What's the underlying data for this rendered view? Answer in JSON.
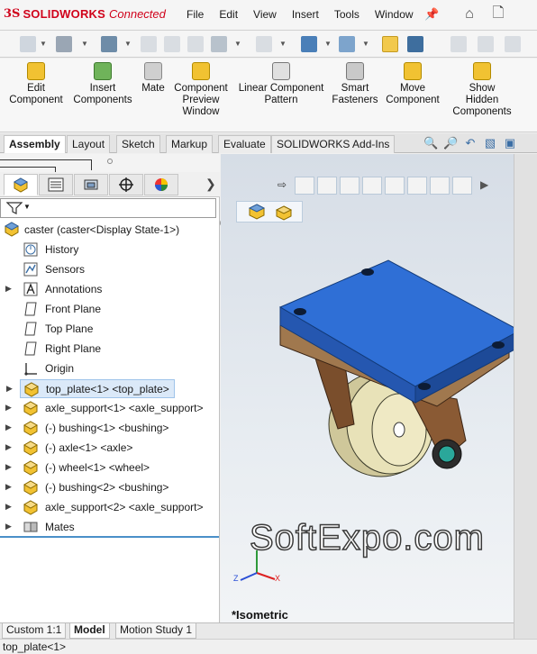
{
  "app": {
    "logo_ds": "3S",
    "logo_name": "SOLIDWORKS",
    "logo_suffix": "Connected"
  },
  "menu": [
    "File",
    "Edit",
    "View",
    "Insert",
    "Tools",
    "Window"
  ],
  "command_manager": [
    {
      "id": "edit-component",
      "label": "Edit\nComponent"
    },
    {
      "id": "insert-components",
      "label": "Insert\nComponents"
    },
    {
      "id": "mate",
      "label": "Mate"
    },
    {
      "id": "component-preview-window",
      "label": "Component\nPreview\nWindow"
    },
    {
      "id": "linear-component-pattern",
      "label": "Linear Component\nPattern"
    },
    {
      "id": "smart-fasteners",
      "label": "Smart\nFasteners"
    },
    {
      "id": "move-component",
      "label": "Move\nComponent"
    },
    {
      "id": "show-hidden-components",
      "label": "Show\nHidden\nComponents"
    }
  ],
  "tabs": [
    "Assembly",
    "Layout",
    "Sketch",
    "Markup",
    "Evaluate",
    "SOLIDWORKS Add-Ins"
  ],
  "active_tab": "Assembly",
  "tree": {
    "root": "caster  (caster<Display State-1>)",
    "items": [
      {
        "label": "History",
        "expandable": false,
        "kind": "history"
      },
      {
        "label": "Sensors",
        "expandable": false,
        "kind": "sensors"
      },
      {
        "label": "Annotations",
        "expandable": true,
        "kind": "annotations"
      },
      {
        "label": "Front Plane",
        "expandable": false,
        "kind": "plane"
      },
      {
        "label": "Top Plane",
        "expandable": false,
        "kind": "plane"
      },
      {
        "label": "Right Plane",
        "expandable": false,
        "kind": "plane"
      },
      {
        "label": "Origin",
        "expandable": false,
        "kind": "origin"
      },
      {
        "label": "top_plate<1> <top_plate>",
        "expandable": true,
        "kind": "part",
        "selected": true
      },
      {
        "label": "axle_support<1> <axle_support>",
        "expandable": true,
        "kind": "part"
      },
      {
        "label": "(-) bushing<1> <bushing>",
        "expandable": true,
        "kind": "part"
      },
      {
        "label": "(-) axle<1> <axle>",
        "expandable": true,
        "kind": "part"
      },
      {
        "label": "(-) wheel<1> <wheel>",
        "expandable": true,
        "kind": "part"
      },
      {
        "label": "(-) bushing<2> <bushing>",
        "expandable": true,
        "kind": "part"
      },
      {
        "label": "axle_support<2> <axle_support>",
        "expandable": true,
        "kind": "part"
      },
      {
        "label": "Mates",
        "expandable": true,
        "kind": "mates"
      }
    ]
  },
  "viewport": {
    "watermark": "SoftExpo.com",
    "view_label": "*Isometric"
  },
  "bottom_tabs": [
    "Custom 1:1",
    "Model",
    "Motion Study 1"
  ],
  "status": "top_plate<1>",
  "colors": {
    "accent": "#d0021b",
    "plate": "#2f6fd6",
    "support": "#8a5a34",
    "wheel": "#e8e2b8",
    "selection": "#dbe9f8"
  }
}
